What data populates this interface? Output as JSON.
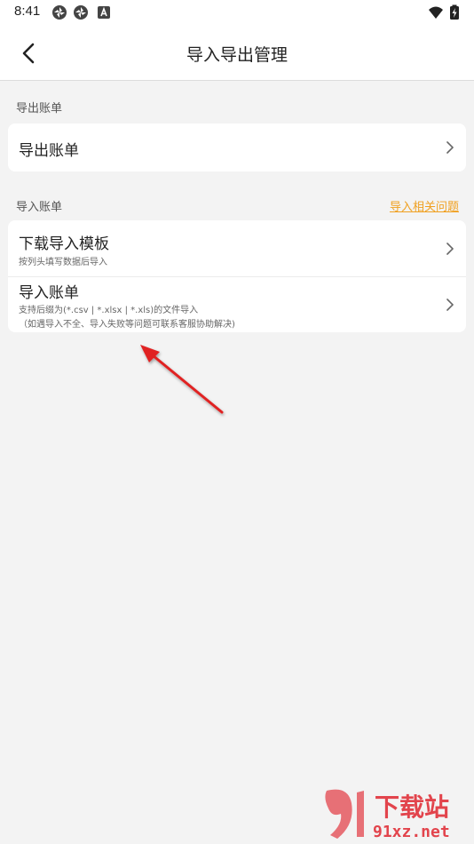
{
  "status_bar": {
    "time": "8:41",
    "icons_left": [
      "app-notification-icon",
      "app-notification-icon",
      "font-a-icon"
    ],
    "icons_right": [
      "wifi-icon",
      "battery-charging-icon"
    ]
  },
  "header": {
    "title": "导入导出管理",
    "back_icon": "chevron-left-icon"
  },
  "export_section": {
    "label": "导出账单",
    "items": [
      {
        "title": "导出账单"
      }
    ]
  },
  "import_section": {
    "label": "导入账单",
    "help_link": "导入相关问题",
    "items": [
      {
        "title": "下载导入模板",
        "subtitle": "按列头填写数据后导入"
      },
      {
        "title": "导入账单",
        "subtitle_line1": "支持后缀为(*.csv | *.xlsx | *.xls)的文件导入",
        "subtitle_line2": "（如遇导入不全、导入失败等问题可联系客服协助解决)"
      }
    ]
  },
  "watermark": {
    "brand_text": "下载站",
    "domain_text": "91xz.net",
    "logo_text": "9"
  },
  "colors": {
    "background": "#f3f3f3",
    "card": "#ffffff",
    "accent_link": "#f0a020",
    "annotation_arrow": "#e02020",
    "watermark_red": "#e0262f"
  }
}
